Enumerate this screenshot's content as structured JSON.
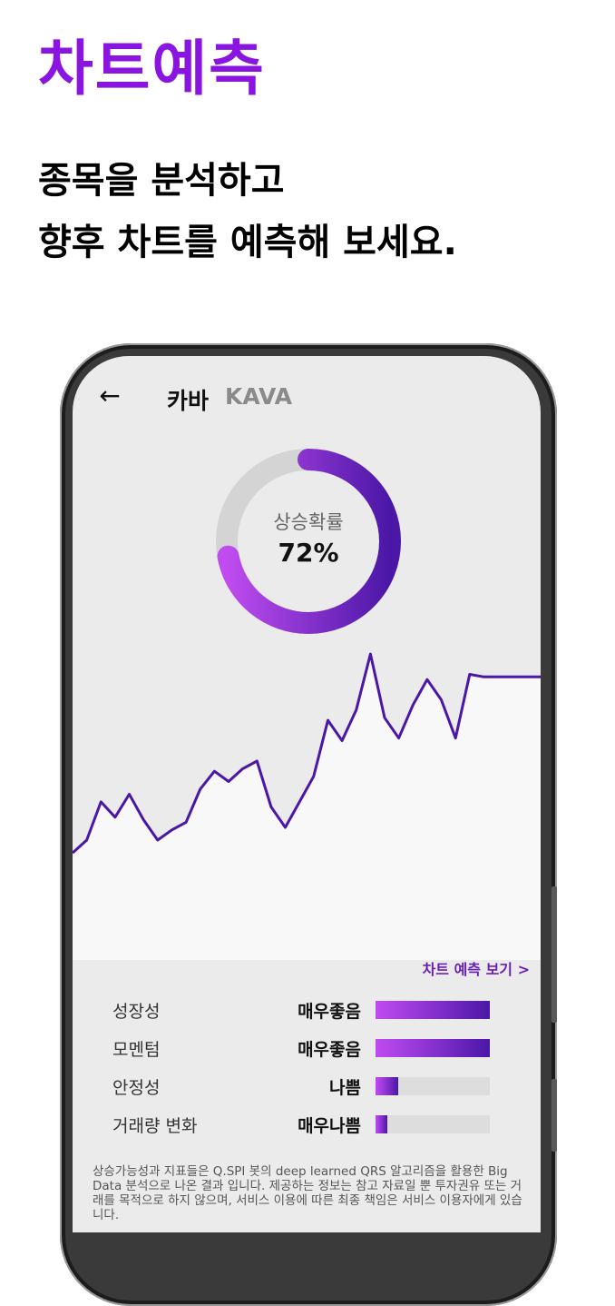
{
  "hero": {
    "title": "차트예측",
    "subtitle_line1": "종목을 분석하고",
    "subtitle_line2": "향후 차트를 예측해 보세요."
  },
  "header": {
    "back_icon": "arrow-left-icon",
    "coin_name": "카바",
    "coin_ticker": "KAVA"
  },
  "probability": {
    "label": "상승확률",
    "value_text": "72%",
    "value": 0.72
  },
  "chart_data": {
    "type": "line",
    "x": [
      0,
      1,
      2,
      3,
      4,
      5,
      6,
      7,
      8,
      9,
      10,
      11,
      12,
      13,
      14,
      15,
      16,
      17,
      18,
      19,
      20,
      21,
      22,
      23,
      24,
      25,
      26,
      27,
      28,
      29,
      30,
      31,
      32,
      33
    ],
    "values": [
      42,
      47,
      62,
      56,
      65,
      55,
      47,
      51,
      54,
      67,
      74,
      70,
      75,
      78,
      60,
      52,
      62,
      72,
      94,
      86,
      98,
      120,
      95,
      87,
      100,
      110,
      102,
      87,
      112,
      111,
      111,
      111,
      111,
      111
    ],
    "ylim": [
      0,
      130
    ],
    "color": "#4a17a6",
    "fill_above": "#ebebeb",
    "fill_below": "#f8f8f8"
  },
  "predict_link": "차트 예측 보기 >",
  "metrics": [
    {
      "label": "성장성",
      "rating": "매우좋음",
      "level": 1.0
    },
    {
      "label": "모멘텀",
      "rating": "매우좋음",
      "level": 1.0
    },
    {
      "label": "안정성",
      "rating": "나쁨",
      "level": 0.2
    },
    {
      "label": "거래량 변화",
      "rating": "매우나쁨",
      "level": 0.1
    }
  ],
  "disclaimer": "상승가능성과 지표들은 Q.SPI 봇의 deep learned QRS 알고리즘을 활용한 Big Data 분석으로 나온 결과 입니다. 제공하는 정보는 참고 자료일 뿐 투자권유 또는 거래를 목적으로 하지 않으며, 서비스 이용에 따른 최종 책임은 서비스 이용자에게 있습니다.",
  "colors": {
    "brand": "#8a14e0",
    "accent_gradient_start": "#c04cf0",
    "accent_gradient_end": "#4a17a6"
  }
}
